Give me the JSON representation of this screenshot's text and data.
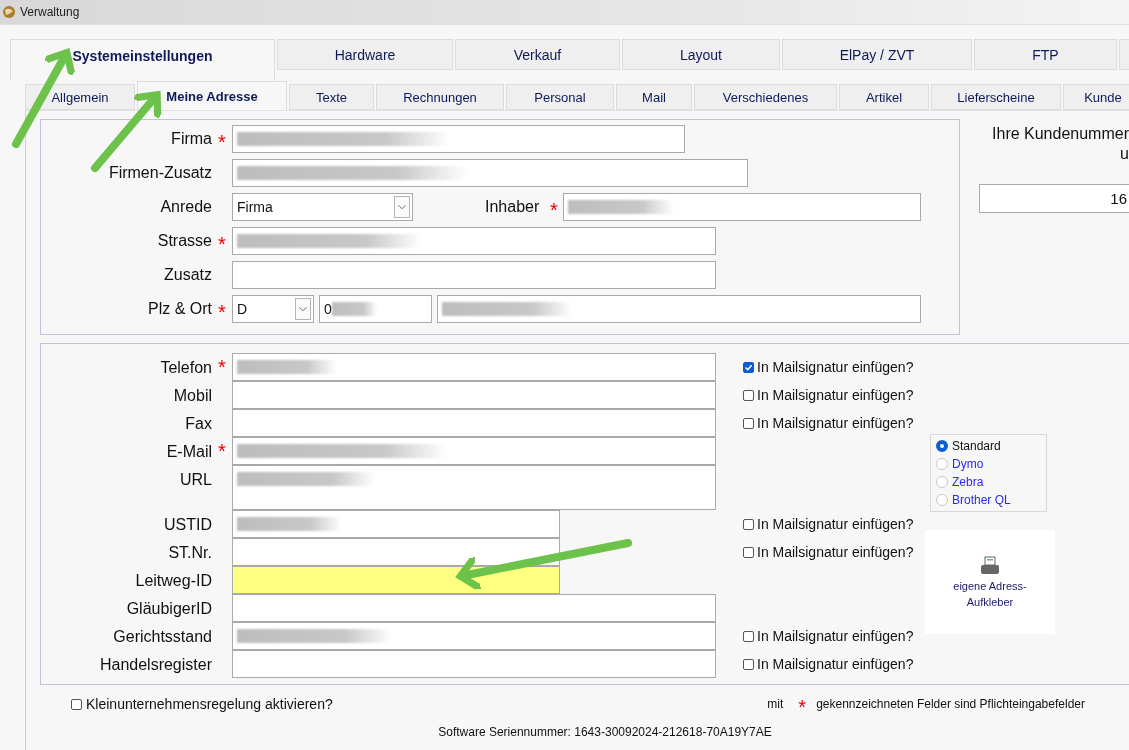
{
  "window": {
    "title": "Verwaltung"
  },
  "main_tabs": [
    {
      "label": "Systemeinstellungen",
      "selected": true
    },
    {
      "label": "Hardware",
      "selected": false
    },
    {
      "label": "Verkauf",
      "selected": false
    },
    {
      "label": "Layout",
      "selected": false
    },
    {
      "label": "ElPay / ZVT",
      "selected": false
    },
    {
      "label": "FTP",
      "selected": false
    }
  ],
  "sub_tabs": [
    {
      "label": "Allgemein",
      "selected": false
    },
    {
      "label": "Meine Adresse",
      "selected": true
    },
    {
      "label": "Texte",
      "selected": false
    },
    {
      "label": "Rechnungen",
      "selected": false
    },
    {
      "label": "Personal",
      "selected": false
    },
    {
      "label": "Mail",
      "selected": false
    },
    {
      "label": "Verschiedenes",
      "selected": false
    },
    {
      "label": "Artikel",
      "selected": false
    },
    {
      "label": "Lieferscheine",
      "selected": false
    },
    {
      "label": "Kunde",
      "selected": false
    }
  ],
  "address": {
    "rows": [
      {
        "label": "Firma",
        "required_mark": "*",
        "fields": [
          {
            "kind": "text",
            "blurred": true
          }
        ]
      },
      {
        "label": "Firmen-Zusatz",
        "fields": [
          {
            "kind": "text",
            "blurred": true
          }
        ]
      },
      {
        "label": "Anrede",
        "fields": [
          {
            "kind": "select",
            "value": "Firma"
          },
          {
            "kind": "label",
            "label": "Inhaber",
            "required_mark": "*"
          },
          {
            "kind": "text",
            "blurred": true
          }
        ]
      },
      {
        "label": "Strasse",
        "required_mark": "*",
        "fields": [
          {
            "kind": "text",
            "blurred": true
          }
        ]
      },
      {
        "label": "Zusatz",
        "fields": [
          {
            "kind": "text"
          }
        ]
      },
      {
        "label": "Plz & Ort",
        "required_mark": "*",
        "fields": [
          {
            "kind": "select",
            "value": "D"
          },
          {
            "kind": "text",
            "value": "0",
            "blurred": true
          },
          {
            "kind": "text",
            "blurred": true
          }
        ]
      }
    ]
  },
  "customer_number": {
    "label": "Ihre Kundenummer",
    "label_continued": "u",
    "value": "16"
  },
  "contact": {
    "rows": [
      {
        "label": "Telefon",
        "required_mark": "*",
        "kind": "wide",
        "blurred": true,
        "highlighted": false,
        "signature": {
          "label": "In Mailsignatur einfügen?",
          "checked": true
        }
      },
      {
        "label": "Mobil",
        "kind": "wide",
        "highlighted": false,
        "signature": {
          "label": "In Mailsignatur einfügen?",
          "checked": false
        }
      },
      {
        "label": "Fax",
        "kind": "wide",
        "highlighted": false,
        "signature": {
          "label": "In Mailsignatur einfügen?",
          "checked": false
        }
      },
      {
        "label": "E-Mail",
        "required_mark": "*",
        "kind": "wide",
        "blurred": true,
        "highlighted": false
      },
      {
        "label": "URL",
        "kind": "tall",
        "blurred": true,
        "highlighted": false
      },
      {
        "label": "USTID",
        "kind": "narrow",
        "blurred": true,
        "highlighted": false,
        "signature": {
          "label": "In Mailsignatur einfügen?",
          "checked": false
        }
      },
      {
        "label": "ST.Nr.",
        "kind": "narrow",
        "highlighted": false,
        "signature": {
          "label": "In Mailsignatur einfügen?",
          "checked": false
        }
      },
      {
        "label": "Leitweg-ID",
        "kind": "narrow",
        "highlighted": true
      },
      {
        "label": "GläubigerID",
        "kind": "wide",
        "highlighted": false
      },
      {
        "label": "Gerichtsstand",
        "kind": "wide",
        "blurred": true,
        "highlighted": false,
        "signature": {
          "label": "In Mailsignatur einfügen?",
          "checked": false
        }
      },
      {
        "label": "Handelsregister",
        "kind": "wide",
        "highlighted": false,
        "signature": {
          "label": "In Mailsignatur einfügen?",
          "checked": false
        }
      }
    ]
  },
  "label_printer": {
    "options": [
      {
        "label": "Standard",
        "selected": true
      },
      {
        "label": "Dymo",
        "selected": false
      },
      {
        "label": "Zebra",
        "selected": false
      },
      {
        "label": "Brother QL",
        "selected": false
      }
    ],
    "button": {
      "lines": [
        "eigene Adress-",
        "Aufkleber"
      ]
    }
  },
  "small_business": {
    "label": "Kleinunternehmensregelung aktivieren?",
    "checked": false
  },
  "required_note": {
    "before": "mit",
    "mark": "*",
    "after": "gekennzeichneten Felder sind Pflichteingabefelder"
  },
  "serial": "Software Seriennummer: 1643-30092024-212618-70A19Y7AE"
}
